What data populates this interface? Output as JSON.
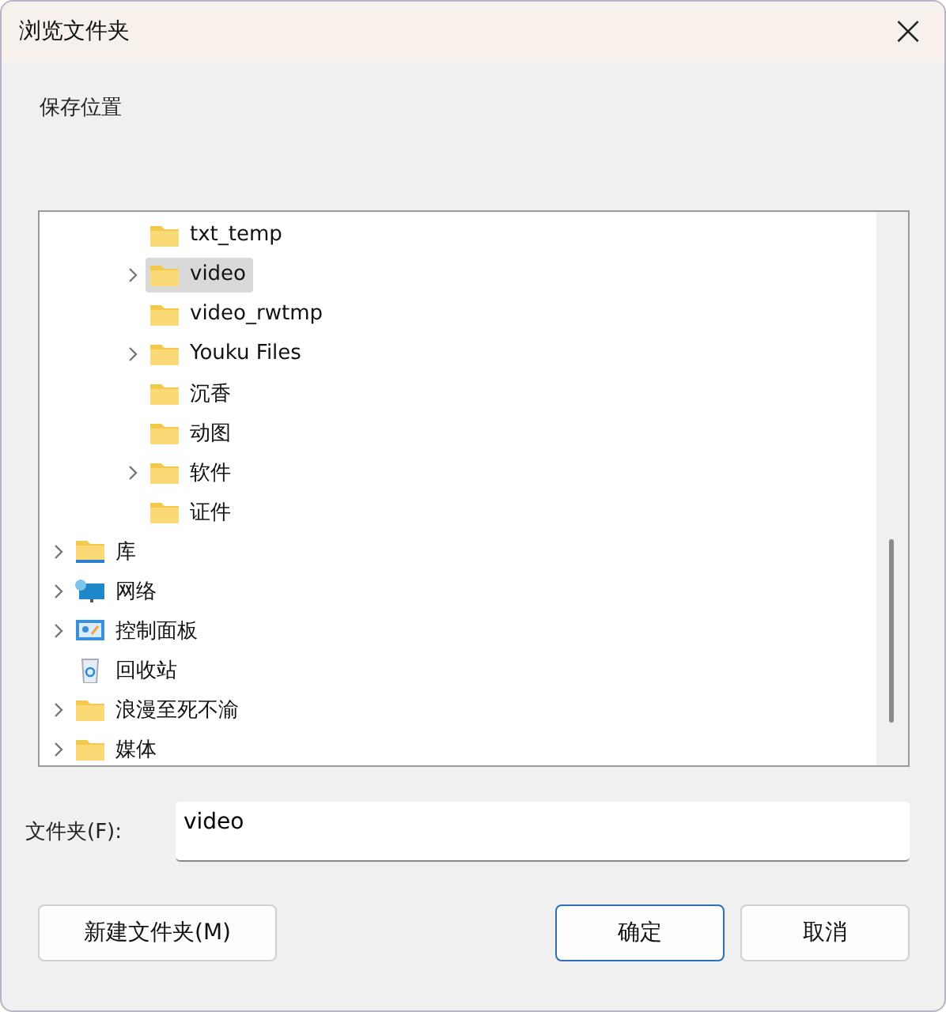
{
  "window": {
    "title": "浏览文件夹",
    "close": "×"
  },
  "prompt": "保存位置",
  "tree": {
    "scrolled_branch_items": [
      {
        "label": "txt_temp",
        "kind": "folder",
        "expandable": false,
        "selected": false
      },
      {
        "label": "video",
        "kind": "folder",
        "expandable": true,
        "selected": true
      },
      {
        "label": "video_rwtmp",
        "kind": "folder",
        "expandable": false,
        "selected": false
      },
      {
        "label": "Youku Files",
        "kind": "folder",
        "expandable": true,
        "selected": false
      },
      {
        "label": "沉香",
        "kind": "folder",
        "expandable": false,
        "selected": false
      },
      {
        "label": "动图",
        "kind": "folder",
        "expandable": false,
        "selected": false
      },
      {
        "label": "软件",
        "kind": "folder",
        "expandable": true,
        "selected": false
      },
      {
        "label": "证件",
        "kind": "folder",
        "expandable": false,
        "selected": false
      }
    ],
    "items": [
      {
        "label": "库",
        "kind": "library",
        "expandable": true,
        "selected": false
      },
      {
        "label": "网络",
        "kind": "network",
        "expandable": true,
        "selected": false
      },
      {
        "label": "控制面板",
        "kind": "control-panel",
        "expandable": true,
        "selected": false
      },
      {
        "label": "回收站",
        "kind": "recycle-bin",
        "expandable": false,
        "selected": false
      },
      {
        "label": "浪漫至死不渝",
        "kind": "folder",
        "expandable": true,
        "selected": false
      },
      {
        "label": "媒体",
        "kind": "folder",
        "expandable": true,
        "selected": false
      }
    ]
  },
  "folder_field": {
    "label": "文件夹(F):",
    "value": "video"
  },
  "buttons": [
    {
      "label": "新建文件夹(M)",
      "default": false
    },
    {
      "label": "确定",
      "default": true
    },
    {
      "label": "取消",
      "default": false
    }
  ]
}
